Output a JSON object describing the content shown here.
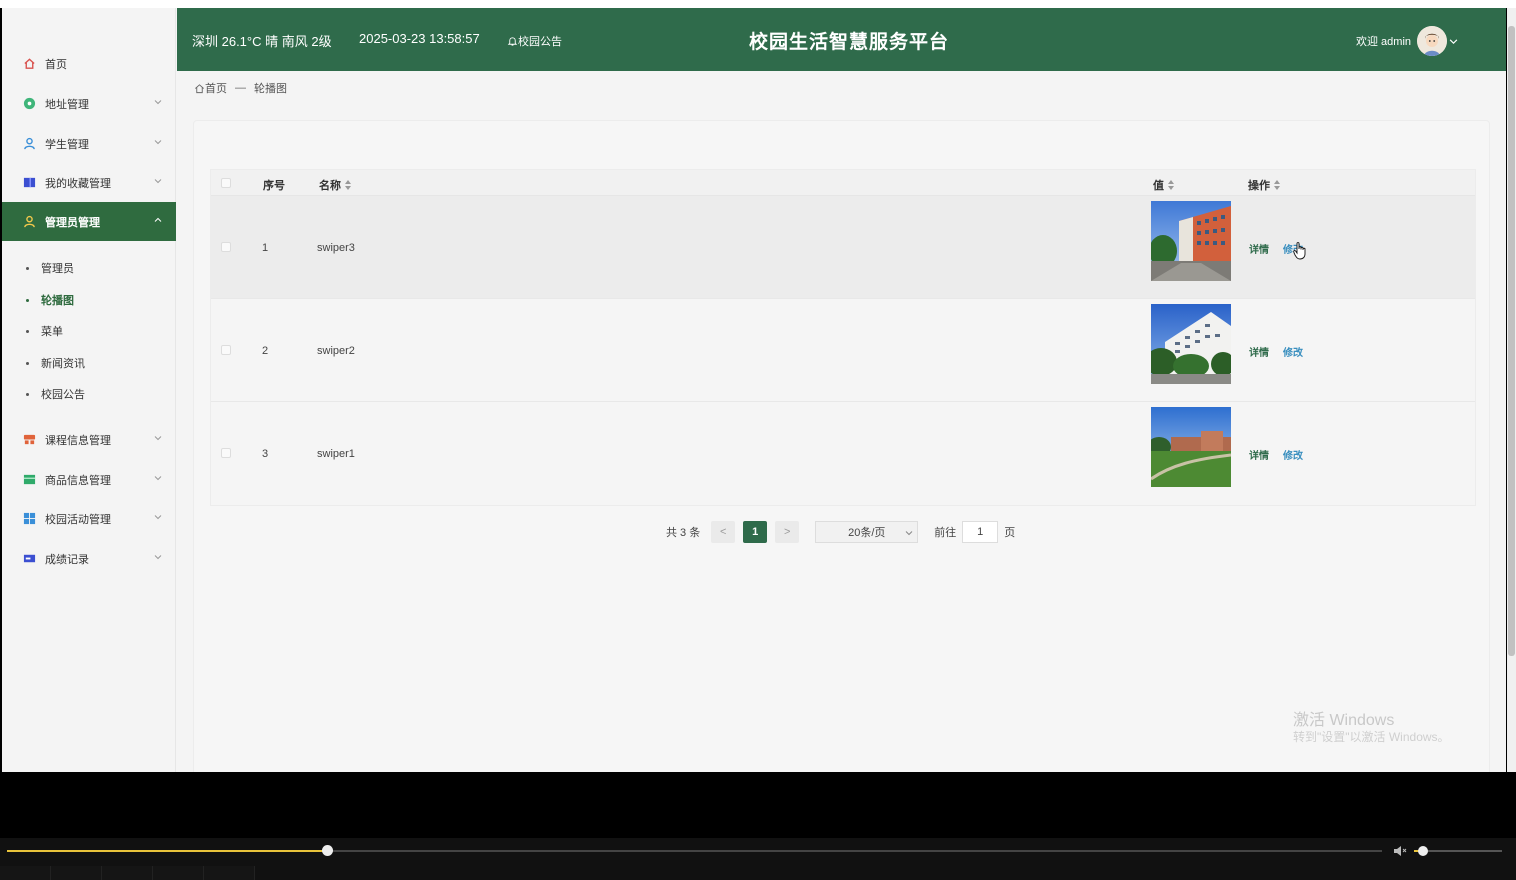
{
  "header": {
    "weather": "深圳 26.1°C 晴 南风 2级",
    "datetime": "2025-03-23 13:58:57",
    "notice": "校园公告",
    "title": "校园生活智慧服务平台",
    "welcome": "欢迎 admin"
  },
  "sidebar": {
    "items": [
      {
        "label": "首页",
        "icon": "home-icon"
      },
      {
        "label": "地址管理",
        "icon": "location-icon"
      },
      {
        "label": "学生管理",
        "icon": "user-icon"
      },
      {
        "label": "我的收藏管理",
        "icon": "bookmark-icon"
      },
      {
        "label": "管理员管理",
        "icon": "admin-icon"
      },
      {
        "label": "课程信息管理",
        "icon": "course-icon"
      },
      {
        "label": "商品信息管理",
        "icon": "goods-icon"
      },
      {
        "label": "校园活动管理",
        "icon": "activity-icon"
      },
      {
        "label": "成绩记录",
        "icon": "score-icon"
      }
    ],
    "sub_items": [
      "管理员",
      "轮播图",
      "菜单",
      "新闻资讯",
      "校园公告"
    ]
  },
  "breadcrumb": {
    "home": "首页",
    "sep": "—",
    "current": "轮播图"
  },
  "table": {
    "headers": {
      "index": "序号",
      "name": "名称",
      "value": "值",
      "action": "操作"
    },
    "rows": [
      {
        "index": "1",
        "name": "swiper3",
        "detail": "详情",
        "edit": "修改"
      },
      {
        "index": "2",
        "name": "swiper2",
        "detail": "详情",
        "edit": "修改"
      },
      {
        "index": "3",
        "name": "swiper1",
        "detail": "详情",
        "edit": "修改"
      }
    ]
  },
  "pagination": {
    "total": "共 3 条",
    "prev": "<",
    "current_page": "1",
    "next": ">",
    "page_size": "20条/页",
    "goto": "前往",
    "goto_value": "1",
    "page_unit": "页"
  },
  "watermark": {
    "line1": "激活 Windows",
    "line2": "转到\"设置\"以激活 Windows。"
  },
  "player": {
    "progress": 0.233,
    "volume": 0.09
  },
  "colors": {
    "primary": "#2f6b4b",
    "link": "#3a8fbf",
    "progress": "#e8c33b"
  }
}
